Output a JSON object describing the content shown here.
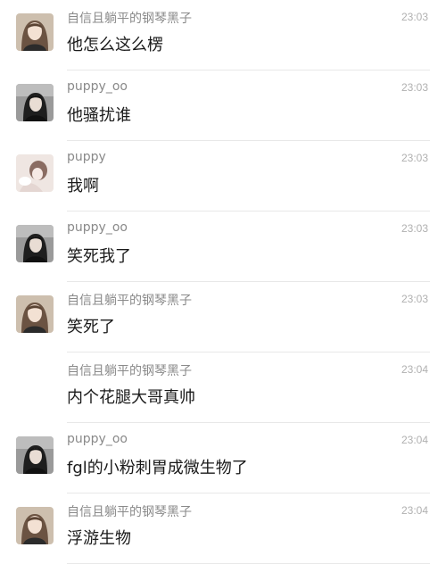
{
  "messages": [
    {
      "sender": "自信且躺平的钢琴黑子",
      "time": "23:03",
      "text": "他怎么这么楞",
      "avatar": "avatar-girl-long-hair"
    },
    {
      "sender": "puppy_oo",
      "time": "23:03",
      "text": "他骚扰谁",
      "avatar": "avatar-girl-dark"
    },
    {
      "sender": "puppy",
      "time": "23:03",
      "text": "我啊",
      "avatar": "avatar-soft-light"
    },
    {
      "sender": "puppy_oo",
      "time": "23:03",
      "text": "笑死我了",
      "avatar": "avatar-girl-dark"
    },
    {
      "sender": "自信且躺平的钢琴黑子",
      "time": "23:03",
      "text": "笑死了",
      "avatar": "avatar-girl-long-hair"
    },
    {
      "sender": "自信且躺平的钢琴黑子",
      "time": "23:04",
      "text": "内个花腿大哥真帅",
      "avatar": ""
    },
    {
      "sender": "puppy_oo",
      "time": "23:04",
      "text": "fgl的小粉刺胃成微生物了",
      "avatar": "avatar-girl-dark"
    },
    {
      "sender": "自信且躺平的钢琴黑子",
      "time": "23:04",
      "text": "浮游生物",
      "avatar": "avatar-girl-long-hair"
    }
  ]
}
